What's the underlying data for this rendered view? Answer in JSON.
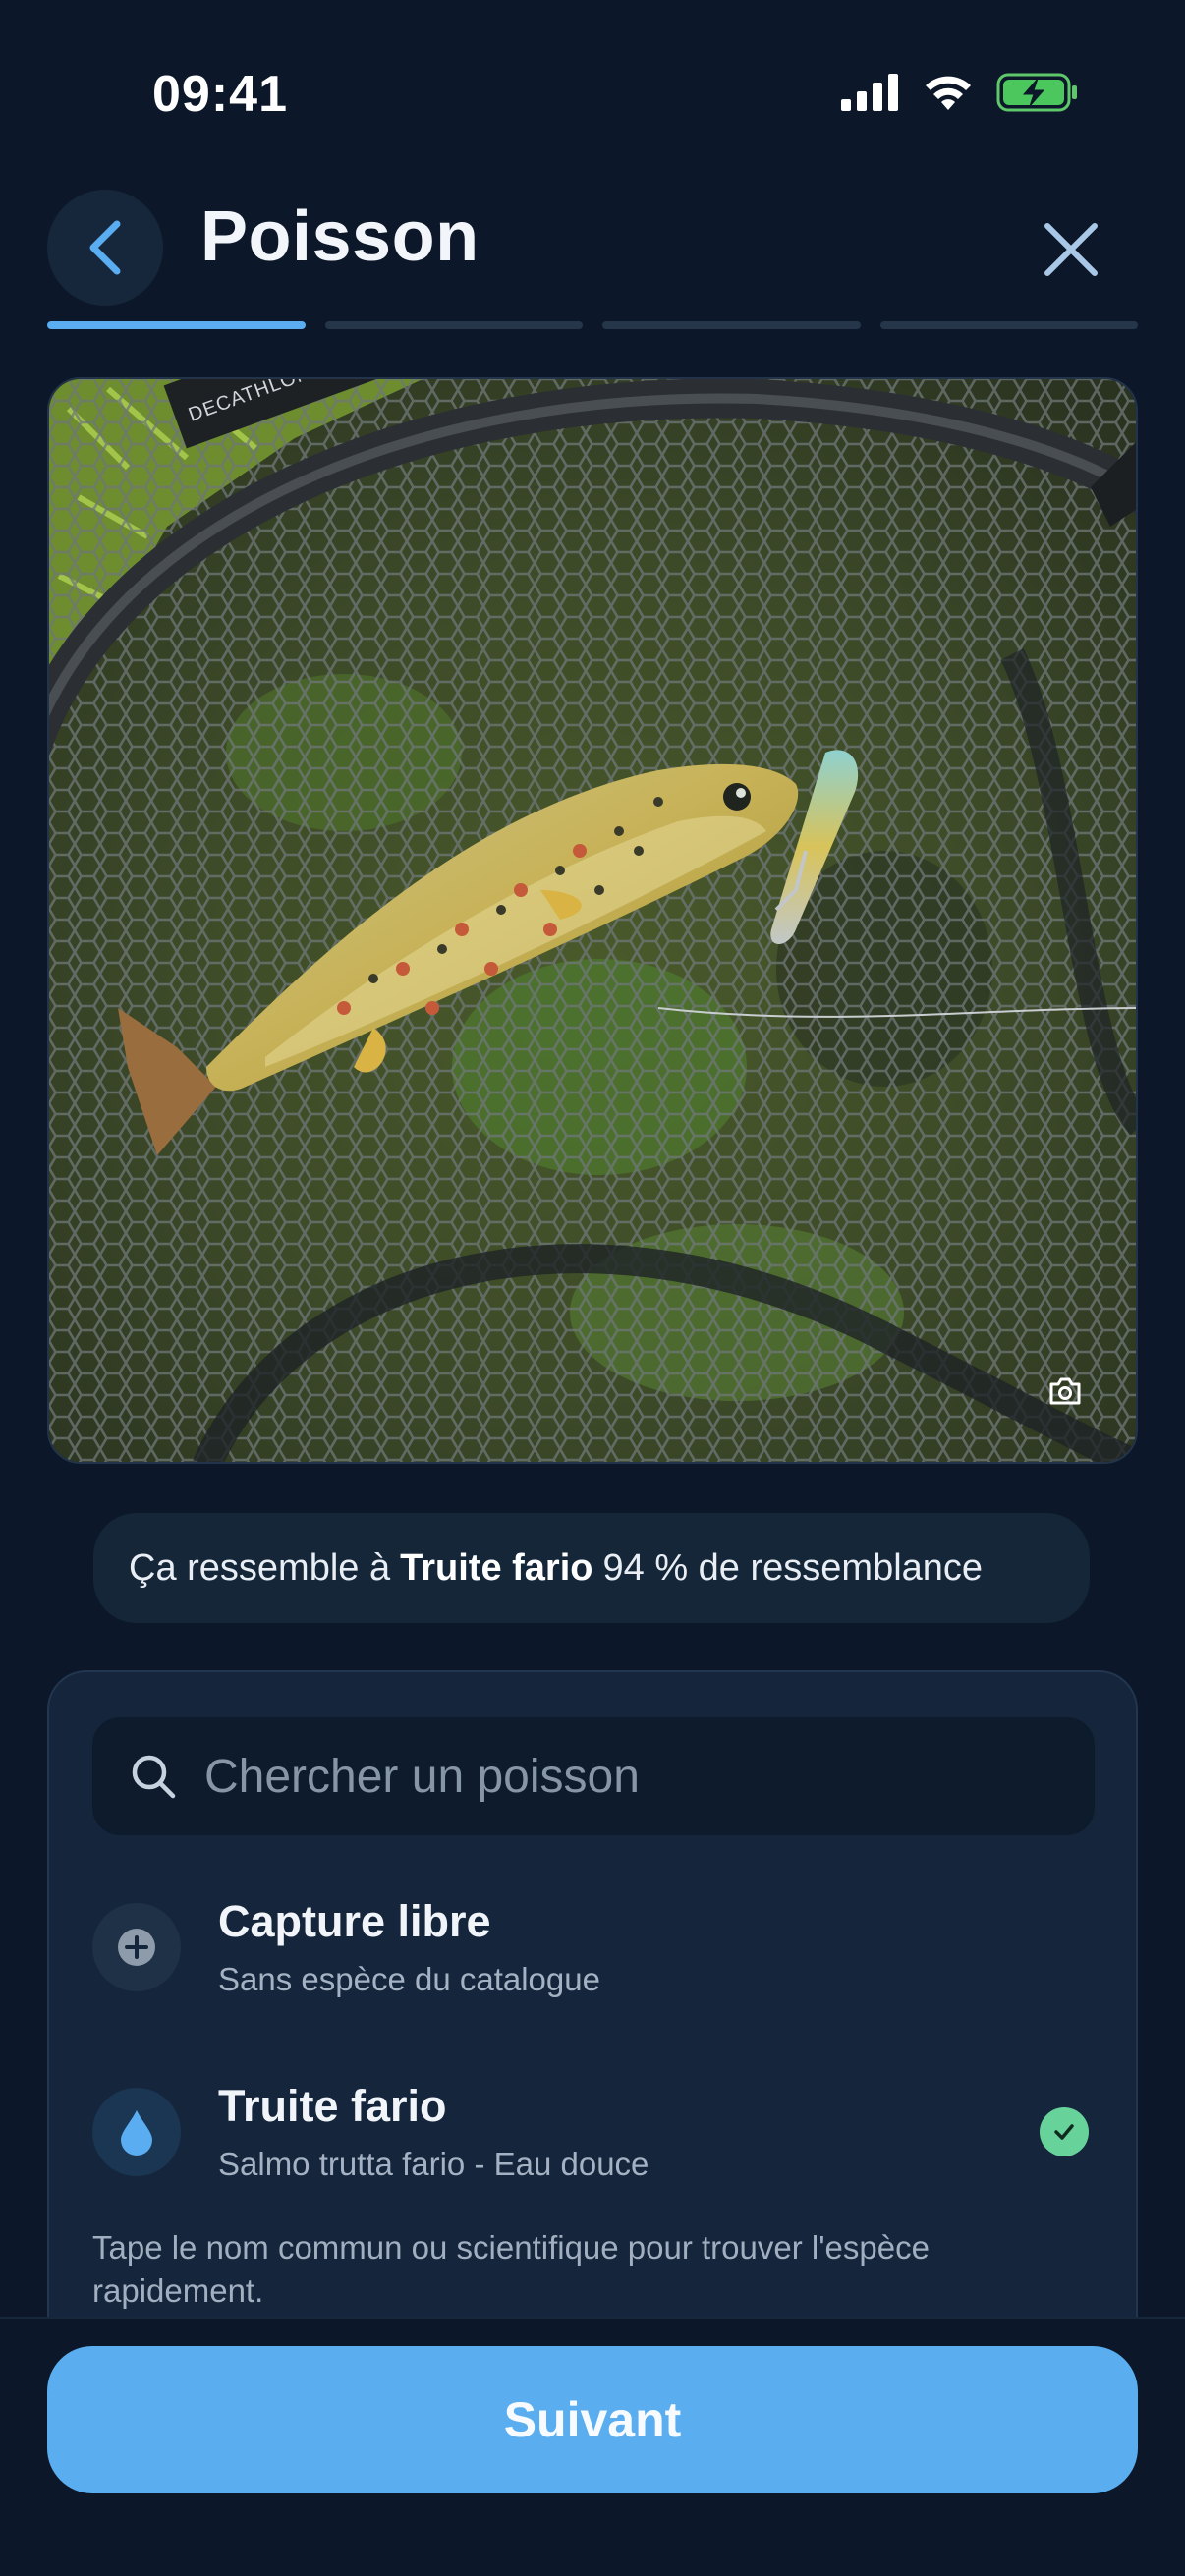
{
  "status_bar": {
    "time": "09:41"
  },
  "header": {
    "title": "Poisson",
    "steps_total": 4,
    "active_step": 1
  },
  "photo": {
    "net_label": "DECATHLON | CAPERLAN",
    "camera_icon": "camera-icon"
  },
  "suggestion": {
    "prefix": "Ça ressemble à",
    "species": "Truite fario",
    "suffix": "94 % de ressemblance"
  },
  "panel": {
    "search_placeholder": "Chercher un poisson",
    "options": [
      {
        "title": "Capture libre",
        "subtitle": "Sans espèce du catalogue",
        "icon": "plus-icon",
        "selected": false
      },
      {
        "title": "Truite fario",
        "subtitle": "Salmo trutta fario - Eau douce",
        "icon": "water-drop-icon",
        "selected": true
      }
    ],
    "hint": "Tape le nom commun ou scientifique pour trouver l'espèce rapidement."
  },
  "footer": {
    "next_label": "Suivant"
  },
  "colors": {
    "background": "#0c1829",
    "accent": "#5aaeef",
    "panel": "#15263c",
    "success": "#67d39a"
  }
}
